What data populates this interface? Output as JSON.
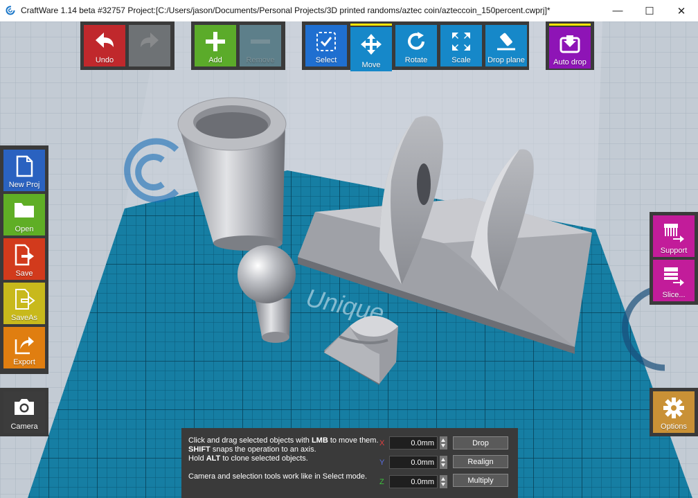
{
  "window": {
    "title": "CraftWare 1.14 beta #32757   Project:[C:/Users/jason/Documents/Personal Projects/3D printed randoms/aztec coin/azteccoin_150percent.cwprj]*",
    "minimize_glyph": "—",
    "maximize_glyph": "☐",
    "close_glyph": "✕"
  },
  "toolbar": {
    "undo": "Undo",
    "redo": "",
    "add": "Add",
    "remove": "Remove",
    "select": "Select",
    "move": "Move",
    "rotate": "Rotate",
    "scale": "Scale",
    "drop_plane": "Drop plane",
    "auto_drop": "Auto drop"
  },
  "sidebar_left": {
    "new_proj": "New Proj",
    "open": "Open",
    "save": "Save",
    "save_as": "SaveAs",
    "export": "Export",
    "camera": "Camera"
  },
  "sidebar_right": {
    "support": "Support",
    "slice": "Slice...",
    "options": "Options"
  },
  "watermark": "Unique",
  "hint": {
    "line1_pre": "Click and drag selected objects with ",
    "line1_bold": "LMB",
    "line1_post": " to move them.",
    "line2_bold": "SHIFT",
    "line2_post": " snaps the operation to an axis.",
    "line3_pre": "Hold ",
    "line3_bold": "ALT",
    "line3_post": " to clone selected objects.",
    "line4": "Camera and selection tools work like in Select mode."
  },
  "move_panel": {
    "x_label": "X",
    "y_label": "Y",
    "z_label": "Z",
    "x_value": "0.0mm",
    "y_value": "0.0mm",
    "z_value": "0.0mm",
    "drop": "Drop",
    "realign": "Realign",
    "multiply": "Multiply"
  },
  "colors": {
    "undo": "#c0282c",
    "add": "#5bab2a",
    "tool_blue": "#1688c9",
    "select_blue": "#1f6fd0",
    "auto_drop": "#8e14b6",
    "new_proj": "#2a62c0",
    "open": "#5fae25",
    "save": "#d23a1c",
    "save_as": "#c8b91c",
    "export": "#e07e10",
    "support": "#c21c9a",
    "options": "#c99136",
    "axis_x": "#e04040",
    "axis_y": "#5a6ee0",
    "axis_z": "#3cc43c"
  }
}
